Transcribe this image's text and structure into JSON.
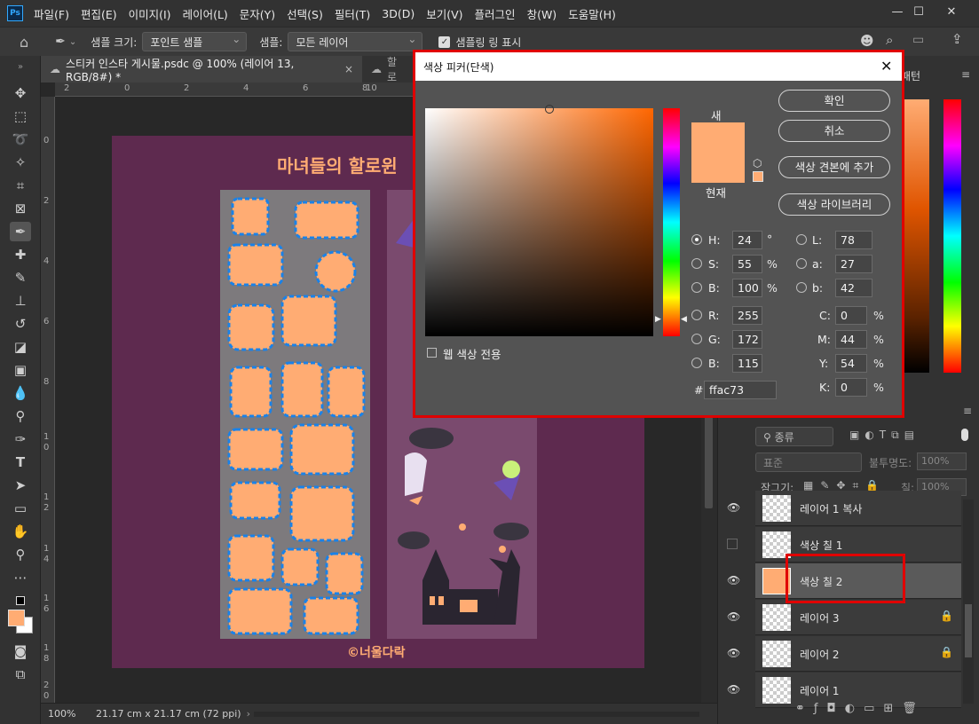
{
  "app": {
    "logo": "Ps"
  },
  "menu": [
    "파일(F)",
    "편집(E)",
    "이미지(I)",
    "레이어(L)",
    "문자(Y)",
    "선택(S)",
    "필터(T)",
    "3D(D)",
    "보기(V)",
    "플러그인",
    "창(W)",
    "도움말(H)"
  ],
  "options": {
    "sample_size_label": "샘플 크기:",
    "sample_size_value": "포인트 샘플",
    "sample_label": "샘플:",
    "sample_value": "모든 레이어",
    "show_ring_label": "샘플링 링 표시"
  },
  "tabs": [
    {
      "label": "스티커 인스타 게시물.psdc @ 100% (레이어 13, RGB/8#) *"
    },
    {
      "label": "할로"
    }
  ],
  "panel_tab": "패턴",
  "ruler_top": [
    "2",
    "0",
    "2",
    "4",
    "6",
    "8",
    "10"
  ],
  "ruler_left": [
    "0",
    "2",
    "4",
    "6",
    "8",
    "1",
    "0",
    "1",
    "2",
    "1",
    "4",
    "1",
    "6",
    "1",
    "8",
    "2",
    "0"
  ],
  "canvas": {
    "title": "마녀들의 할로윈",
    "watermark": "©너울다락",
    "background_color": "#5e2a4f",
    "sticker_color": "#ffac73",
    "path_color": "#1a82e8"
  },
  "status": {
    "zoom": "100%",
    "doc_info": "21.17 cm x 21.17 cm (72 ppi)"
  },
  "layers_panel": {
    "filter": "종류",
    "blend_mode": "표준",
    "opacity_label": "불투명도:",
    "opacity_value": "100%",
    "lock_label": "잠그기:",
    "fill_label": "칠:",
    "fill_value": "100%",
    "layers": [
      {
        "name": "레이어 1 복사",
        "visible": true,
        "locked": false
      },
      {
        "name": "색상 칠 1",
        "visible": false,
        "locked": false
      },
      {
        "name": "색상 칠 2",
        "visible": true,
        "locked": false,
        "selected": true
      },
      {
        "name": "레이어 3",
        "visible": true,
        "locked": true
      },
      {
        "name": "레이어 2",
        "visible": true,
        "locked": true
      },
      {
        "name": "레이어 1",
        "visible": true,
        "locked": false
      }
    ]
  },
  "color_picker": {
    "title": "색상 피커(단색)",
    "new_label": "새",
    "current_label": "현재",
    "ok": "확인",
    "cancel": "취소",
    "add_swatch": "색상 견본에 추가",
    "color_libraries": "색상 라이브러리",
    "web_only": "웹 색상 전용",
    "H": "24",
    "S": "55",
    "B": "100",
    "R": "255",
    "G": "172",
    "Bv": "115",
    "L": "78",
    "a": "27",
    "b": "42",
    "C": "0",
    "M": "44",
    "Y": "54",
    "K": "0",
    "hex": "ffac73",
    "unit_deg": "°",
    "unit_pct": "%",
    "hash": "#",
    "new_color": "#ffac73",
    "current_color": "#ffac73",
    "highlight_color": "#e00000"
  },
  "fg_color": "#ffac73"
}
